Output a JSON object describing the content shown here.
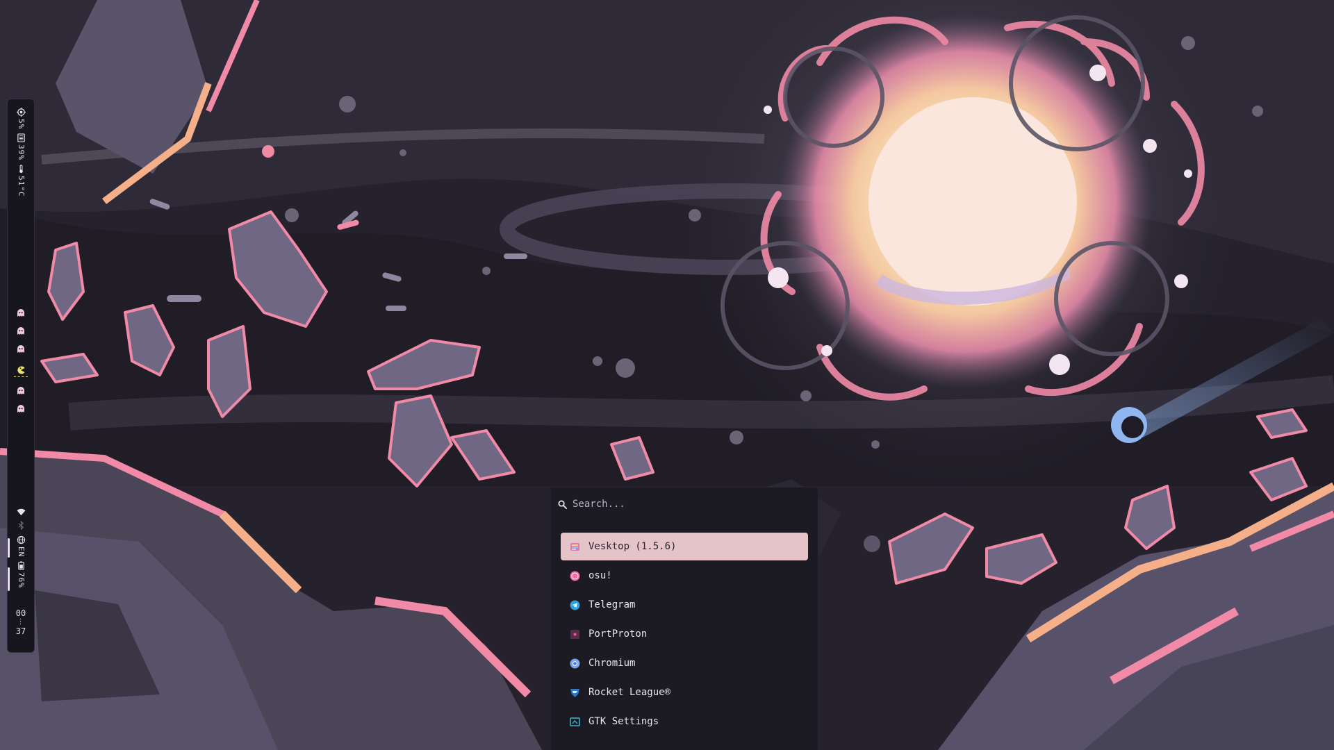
{
  "bar": {
    "cpu": {
      "icon": "cpu-icon",
      "value": "5%"
    },
    "memory": {
      "icon": "memory-icon",
      "value": "39%"
    },
    "temperature": {
      "icon": "thermometer-icon",
      "value": "51°C"
    },
    "workspaces": [
      "ghost-icon",
      "ghost-icon",
      "ghost-icon",
      "pacman-icon",
      "ghost-icon",
      "ghost-icon"
    ],
    "active_workspace": 4,
    "wifi": {
      "icon": "wifi-icon"
    },
    "bluetooth": {
      "icon": "bluetooth-icon"
    },
    "language": {
      "icon": "globe-icon",
      "value": "EN"
    },
    "battery": {
      "icon": "battery-icon",
      "value": "76%"
    },
    "clock": {
      "hours": "00",
      "minutes": "37"
    }
  },
  "launcher": {
    "search_placeholder": "Search...",
    "items": [
      {
        "label": "Vesktop (1.5.6)",
        "icon": "vesktop-icon",
        "selected": true
      },
      {
        "label": "osu!",
        "icon": "osu-icon"
      },
      {
        "label": "Telegram",
        "icon": "telegram-icon"
      },
      {
        "label": "PortProton",
        "icon": "portproton-icon"
      },
      {
        "label": "Chromium",
        "icon": "chromium-icon"
      },
      {
        "label": "Rocket League®",
        "icon": "rocket-league-icon"
      },
      {
        "label": "GTK Settings",
        "icon": "gtk-settings-icon"
      }
    ]
  },
  "colors": {
    "bar_bg": "#17151d",
    "launcher_bg": "#1c1a23",
    "selection": "#e4c4c8",
    "accent_pink": "#f08aa6",
    "accent_peach": "#f5b08a",
    "pacman_yellow": "#e9e36a"
  }
}
